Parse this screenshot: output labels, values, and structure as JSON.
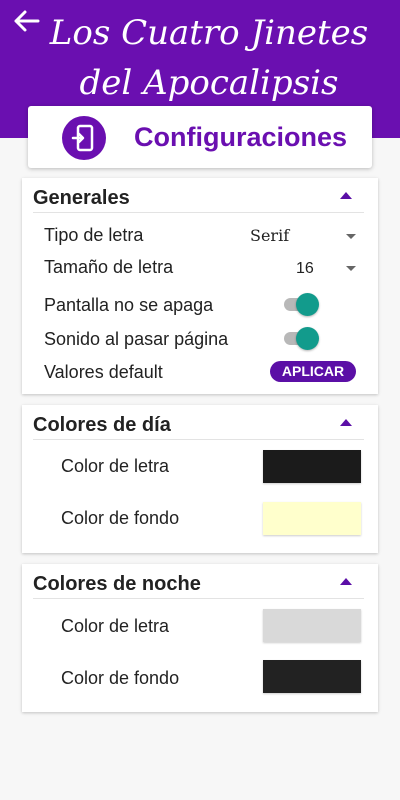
{
  "header": {
    "title": "Los Cuatro Jinetes del Apocalipsis"
  },
  "page": {
    "title": "Configuraciones"
  },
  "icons": {
    "back": "arrow-left-icon",
    "settings": "settings-phone-icon",
    "collapse": "arrow-drop-up-icon",
    "dropdown": "arrow-drop-down-icon"
  },
  "colors": {
    "primary": "#6a0fb0",
    "accent": "#129b8c"
  },
  "generales": {
    "title": "Generales",
    "font_type": {
      "label": "Tipo de letra",
      "value": "Serif"
    },
    "font_size": {
      "label": "Tamaño de letra",
      "value": "16"
    },
    "screen_on": {
      "label": "Pantalla no se apaga",
      "checked": true
    },
    "page_sound": {
      "label": "Sonido al pasar página",
      "checked": true
    },
    "defaults": {
      "label": "Valores default",
      "button": "APLICAR"
    }
  },
  "day_colors": {
    "title": "Colores de día",
    "text_color": {
      "label": "Color de letra",
      "color": "#1b1b1b"
    },
    "bg_color": {
      "label": "Color de fondo",
      "color": "#ffffcc"
    }
  },
  "night_colors": {
    "title": "Colores de noche",
    "text_color": {
      "label": "Color de letra",
      "color": "#d9d9d9"
    },
    "bg_color": {
      "label": "Color de fondo",
      "color": "#222222"
    }
  }
}
